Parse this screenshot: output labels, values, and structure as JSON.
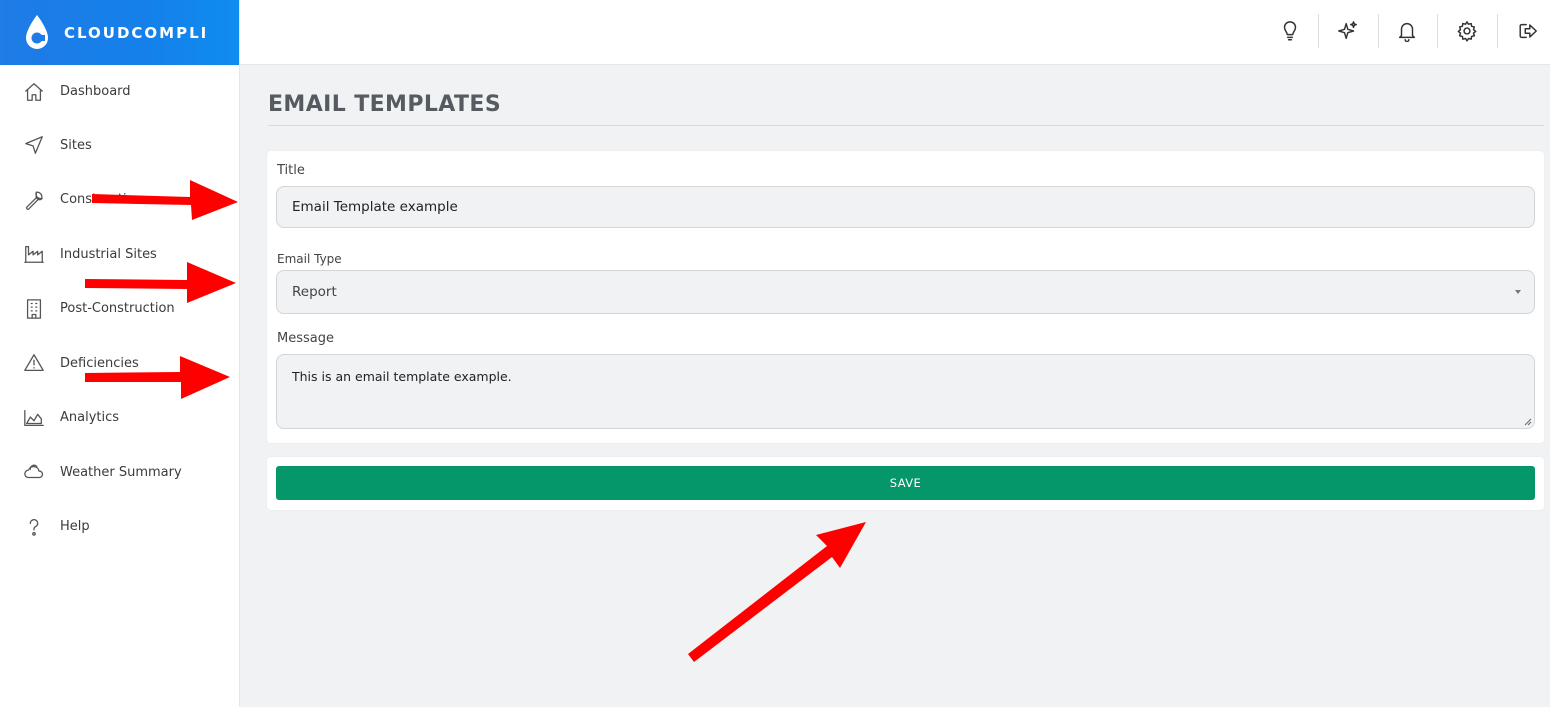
{
  "brand": {
    "name": "CLOUDCOMPLI"
  },
  "sidebar": {
    "items": [
      {
        "label": "Dashboard",
        "icon": "home-icon"
      },
      {
        "label": "Sites",
        "icon": "navigation-icon"
      },
      {
        "label": "Construction",
        "icon": "wrench-icon"
      },
      {
        "label": "Industrial Sites",
        "icon": "factory-icon"
      },
      {
        "label": "Post-Construction",
        "icon": "building-icon"
      },
      {
        "label": "Deficiencies",
        "icon": "warning-icon"
      },
      {
        "label": "Analytics",
        "icon": "area-chart-icon"
      },
      {
        "label": "Weather Summary",
        "icon": "cloud-icon"
      },
      {
        "label": "Help",
        "icon": "help-icon"
      }
    ]
  },
  "header": {
    "icons": [
      "lightbulb-icon",
      "sparkles-icon",
      "bell-icon",
      "gear-icon",
      "logout-icon"
    ]
  },
  "main": {
    "page_title": "EMAIL TEMPLATES",
    "form": {
      "title_label": "Title",
      "title_value": "Email Template example",
      "email_type_label": "Email Type",
      "email_type_value": "Report",
      "message_label": "Message",
      "message_value": "This is an email template example."
    },
    "save_label": "SAVE"
  },
  "colors": {
    "brand_blue": "#1f7be6",
    "save_green": "#059669",
    "annotation_red": "#ff0000",
    "page_bg": "#f1f2f4"
  }
}
